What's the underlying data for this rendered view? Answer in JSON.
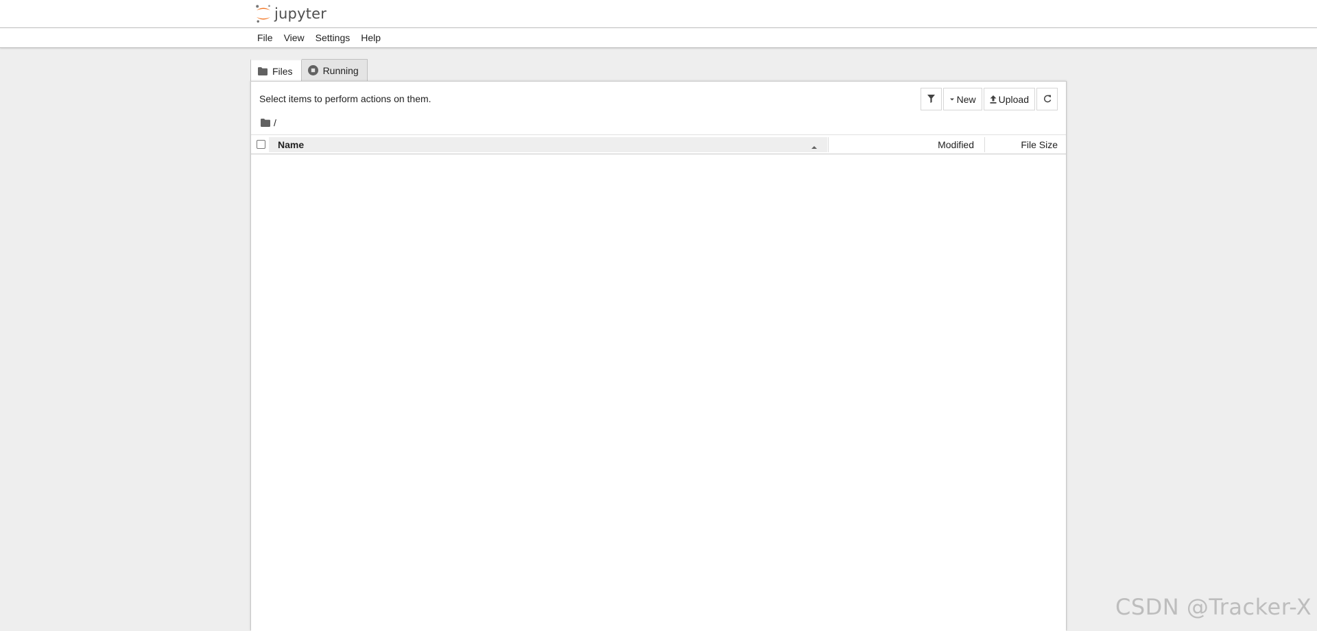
{
  "header": {
    "logo_text": "jupyter"
  },
  "menu": {
    "items": [
      "File",
      "View",
      "Settings",
      "Help"
    ]
  },
  "tabs": [
    {
      "label": "Files",
      "icon": "folder-icon",
      "active": true
    },
    {
      "label": "Running",
      "icon": "stop-circle-icon",
      "active": false
    }
  ],
  "file_browser": {
    "instructions": "Select items to perform actions on them.",
    "toolbar": {
      "filter_icon": "filter-icon",
      "new_label": "New",
      "upload_label": "Upload",
      "refresh_icon": "refresh-icon"
    },
    "breadcrumb": {
      "path": "/"
    },
    "columns": {
      "name": "Name",
      "modified": "Modified",
      "file_size": "File Size"
    },
    "sort": {
      "column": "Name",
      "direction": "ascending"
    },
    "files": []
  },
  "watermark": "CSDN @Tracker-X",
  "colors": {
    "logo_orange": "#f37726",
    "page_background": "#eeeeee",
    "panel_background": "#ffffff"
  }
}
